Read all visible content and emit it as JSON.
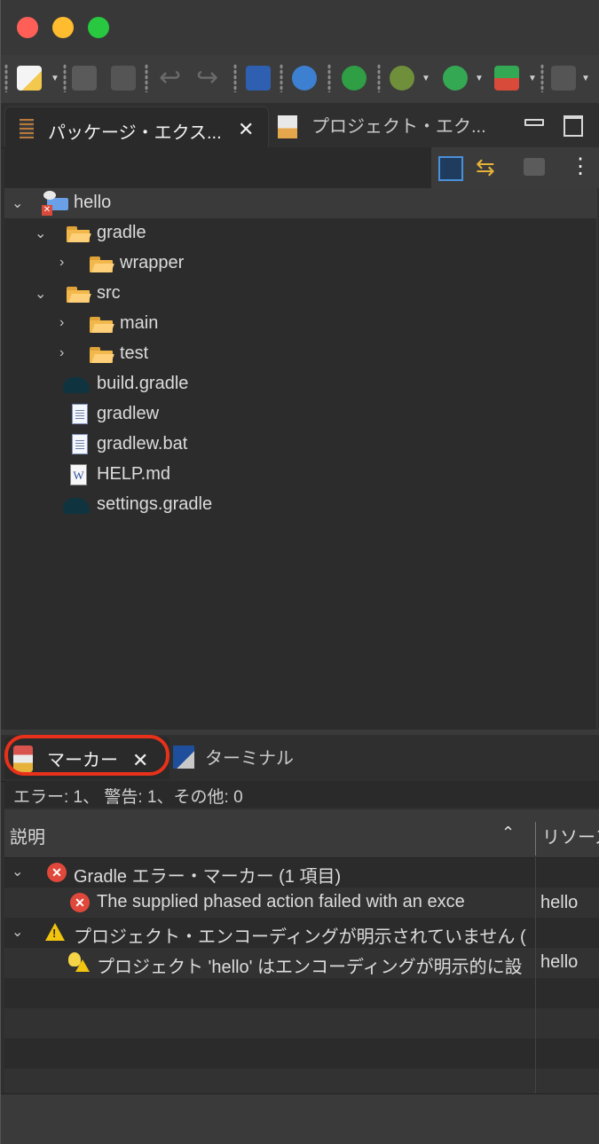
{
  "window": {
    "title": ""
  },
  "toolbar": {
    "icons": [
      "new-wizard-icon",
      "save-icon",
      "save-all-icon",
      "back-icon",
      "forward-icon",
      "console-icon",
      "settings-gear-icon",
      "power-icon",
      "debug-bug-icon",
      "run-icon",
      "external-tools-icon",
      "stop-icon"
    ]
  },
  "top_tabs": [
    {
      "label": "パッケージ・エクス...",
      "active": true
    },
    {
      "label": "プロジェクト・エク...",
      "active": false
    }
  ],
  "tree": {
    "items": [
      {
        "label": "hello",
        "level": 0,
        "expanded": true,
        "type": "project"
      },
      {
        "label": "gradle",
        "level": 1,
        "expanded": true,
        "type": "folder"
      },
      {
        "label": "wrapper",
        "level": 2,
        "expanded": false,
        "type": "folder"
      },
      {
        "label": "src",
        "level": 1,
        "expanded": true,
        "type": "folder"
      },
      {
        "label": "main",
        "level": 2,
        "expanded": false,
        "type": "folder"
      },
      {
        "label": "test",
        "level": 2,
        "expanded": false,
        "type": "folder"
      },
      {
        "label": "build.gradle",
        "level": 1,
        "type": "gradle"
      },
      {
        "label": "gradlew",
        "level": 1,
        "type": "file"
      },
      {
        "label": "gradlew.bat",
        "level": 1,
        "type": "file"
      },
      {
        "label": "HELP.md",
        "level": 1,
        "type": "word"
      },
      {
        "label": "settings.gradle",
        "level": 1,
        "type": "gradle"
      }
    ]
  },
  "bottom_tabs": [
    {
      "label": "マーカー",
      "active": true
    },
    {
      "label": "ターミナル",
      "active": false
    }
  ],
  "markers": {
    "summary": "エラー: 1、 警告: 1、その他: 0",
    "columns": {
      "description": "説明",
      "resource": "リソース"
    },
    "rows": [
      {
        "level": 0,
        "kind": "error",
        "text": "Gradle エラー・マーカー (1 項目)",
        "resource": ""
      },
      {
        "level": 1,
        "kind": "error",
        "text": "The supplied phased action failed with an exce",
        "resource": "hello"
      },
      {
        "level": 0,
        "kind": "warning",
        "text": "プロジェクト・エンコーディングが明示されていません (",
        "resource": ""
      },
      {
        "level": 1,
        "kind": "info-warning",
        "text": "プロジェクト 'hello' はエンコーディングが明示的に設",
        "resource": "hello"
      }
    ]
  },
  "colors": {
    "highlight": "#e8311a",
    "error": "#e0483b",
    "warning": "#f1c40f"
  }
}
